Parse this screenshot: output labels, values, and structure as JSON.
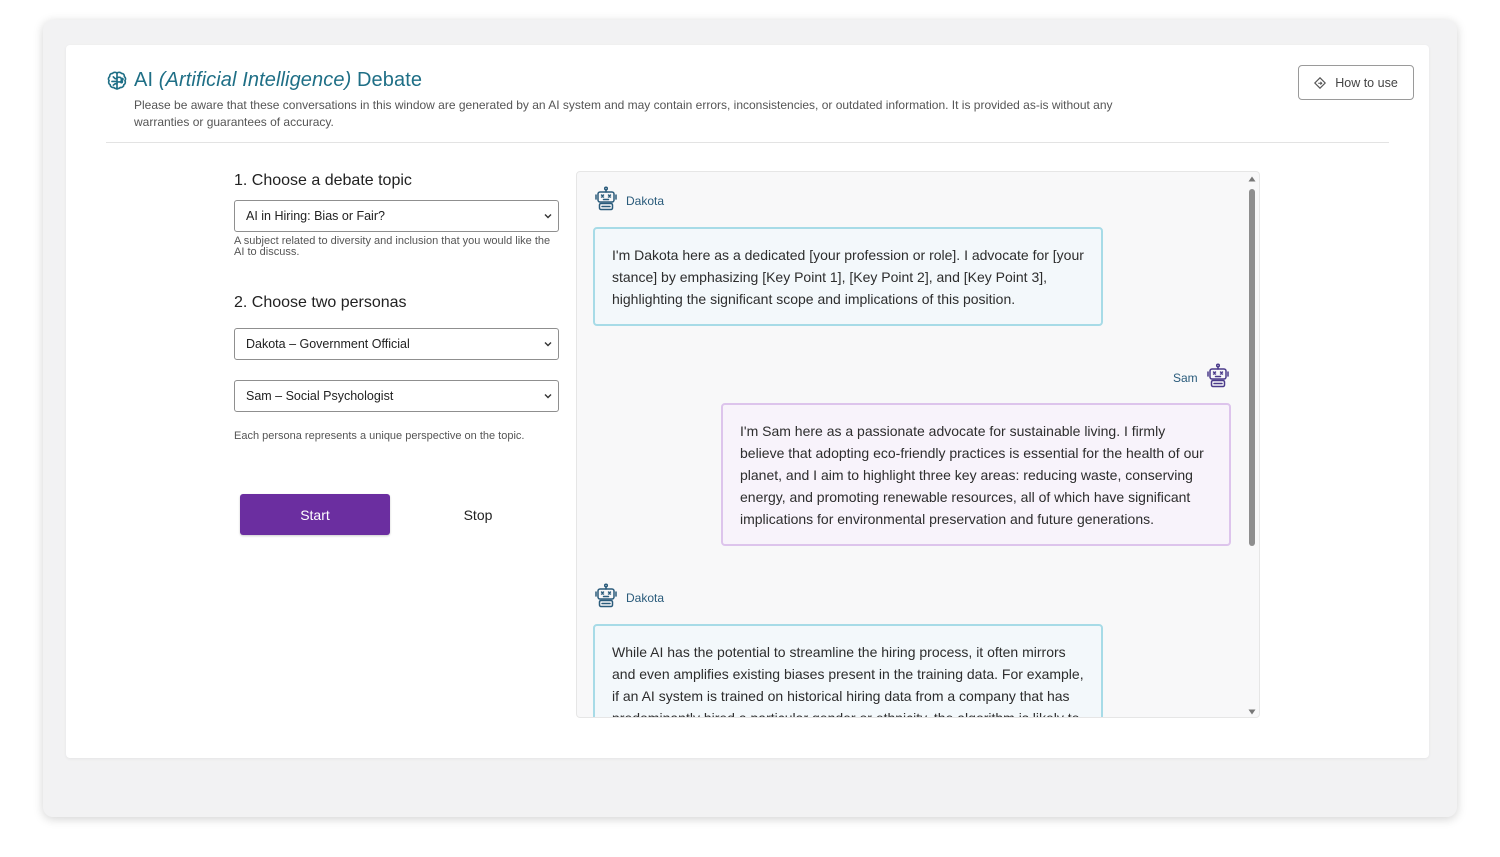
{
  "header": {
    "title_part1": "AI ",
    "title_part2": "(Artificial Intelligence)",
    "title_part3": " Debate",
    "disclaimer": "Please be aware that these conversations in this window are generated by an AI system and may contain errors, inconsistencies, or outdated information. It is provided as-is without any warranties or guarantees of accuracy.",
    "how_to_use_label": "How to use"
  },
  "controls": {
    "step1_title": "1. Choose a debate topic",
    "topic_selected": "AI in Hiring: Bias or Fair?",
    "topic_hint": "A subject related to diversity and inclusion that you would like the AI to discuss.",
    "step2_title": "2. Choose two personas",
    "persona1_selected": "Dakota – Government Official",
    "persona2_selected": "Sam – Social Psychologist",
    "persona_hint": "Each persona represents a unique perspective on the topic.",
    "start_label": "Start",
    "stop_label": "Stop"
  },
  "messages": [
    {
      "speaker": "Dakota",
      "text": "I'm Dakota here as a dedicated [your profession or role]. I advocate for [your stance] by emphasizing [Key Point 1], [Key Point 2], and [Key Point 3], highlighting the significant scope and implications of this position."
    },
    {
      "speaker": "Sam",
      "text": "I'm Sam here as a passionate advocate for sustainable living. I firmly believe that adopting eco-friendly practices is essential for the health of our planet, and I aim to highlight three key areas: reducing waste, conserving energy, and promoting renewable resources, all of which have significant implications for environmental preservation and future generations."
    },
    {
      "speaker": "Dakota",
      "text": "While AI has the potential to streamline the hiring process, it often mirrors and even amplifies existing biases present in the training data. For example, if an AI system is trained on historical hiring data from a company that has predominantly hired a particular gender or ethnicity, the algorithm is likely to"
    }
  ],
  "icons": {
    "logo": "brain-circuit-icon",
    "how_to_use": "diamond-icon",
    "speaker": "robot-icon"
  },
  "colors": {
    "title": "#1f6f86",
    "start_button": "#6b2ea0",
    "dakota_border": "#a7dbe7",
    "sam_border": "#ddc4ec"
  }
}
